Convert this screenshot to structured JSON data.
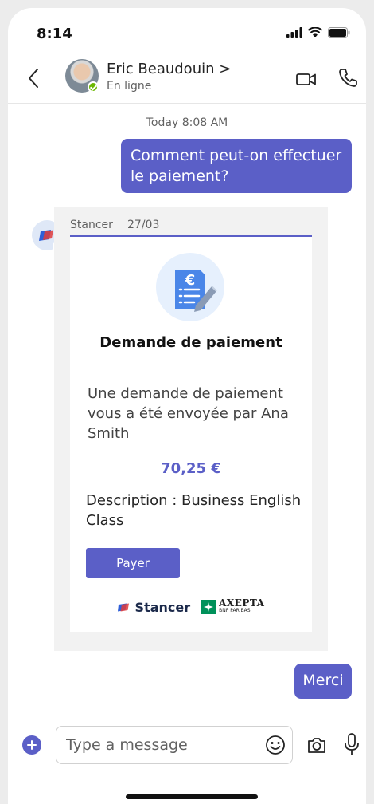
{
  "status_bar": {
    "time": "8:14"
  },
  "header": {
    "contact_name": "Eric Beaudouin >",
    "contact_status": "En ligne"
  },
  "chat": {
    "timestamp": "Today 8:08 AM",
    "messages": [
      {
        "text": "Comment peut-on effectuer le paiement?"
      },
      {
        "text": "Merci"
      }
    ]
  },
  "card": {
    "sender": "Stancer",
    "date": "27/03",
    "title": "Demande de paiement",
    "message": "Une demande de paiement vous a été envoyée par Ana Smith",
    "amount": "70,25 €",
    "description": "Description : Business English Class",
    "pay_label": "Payer",
    "logos": {
      "stancer": "Stancer",
      "axepta": "AXEPTA",
      "axepta_sub": "BNP PARIBAS"
    }
  },
  "compose": {
    "placeholder": "Type a message"
  },
  "colors": {
    "accent": "#5b5fc7",
    "presence": "#6bb700"
  },
  "icons": [
    "back-icon",
    "video-icon",
    "phone-icon",
    "plus-icon",
    "emoji-icon",
    "camera-icon",
    "mic-icon",
    "payment-document-icon"
  ]
}
